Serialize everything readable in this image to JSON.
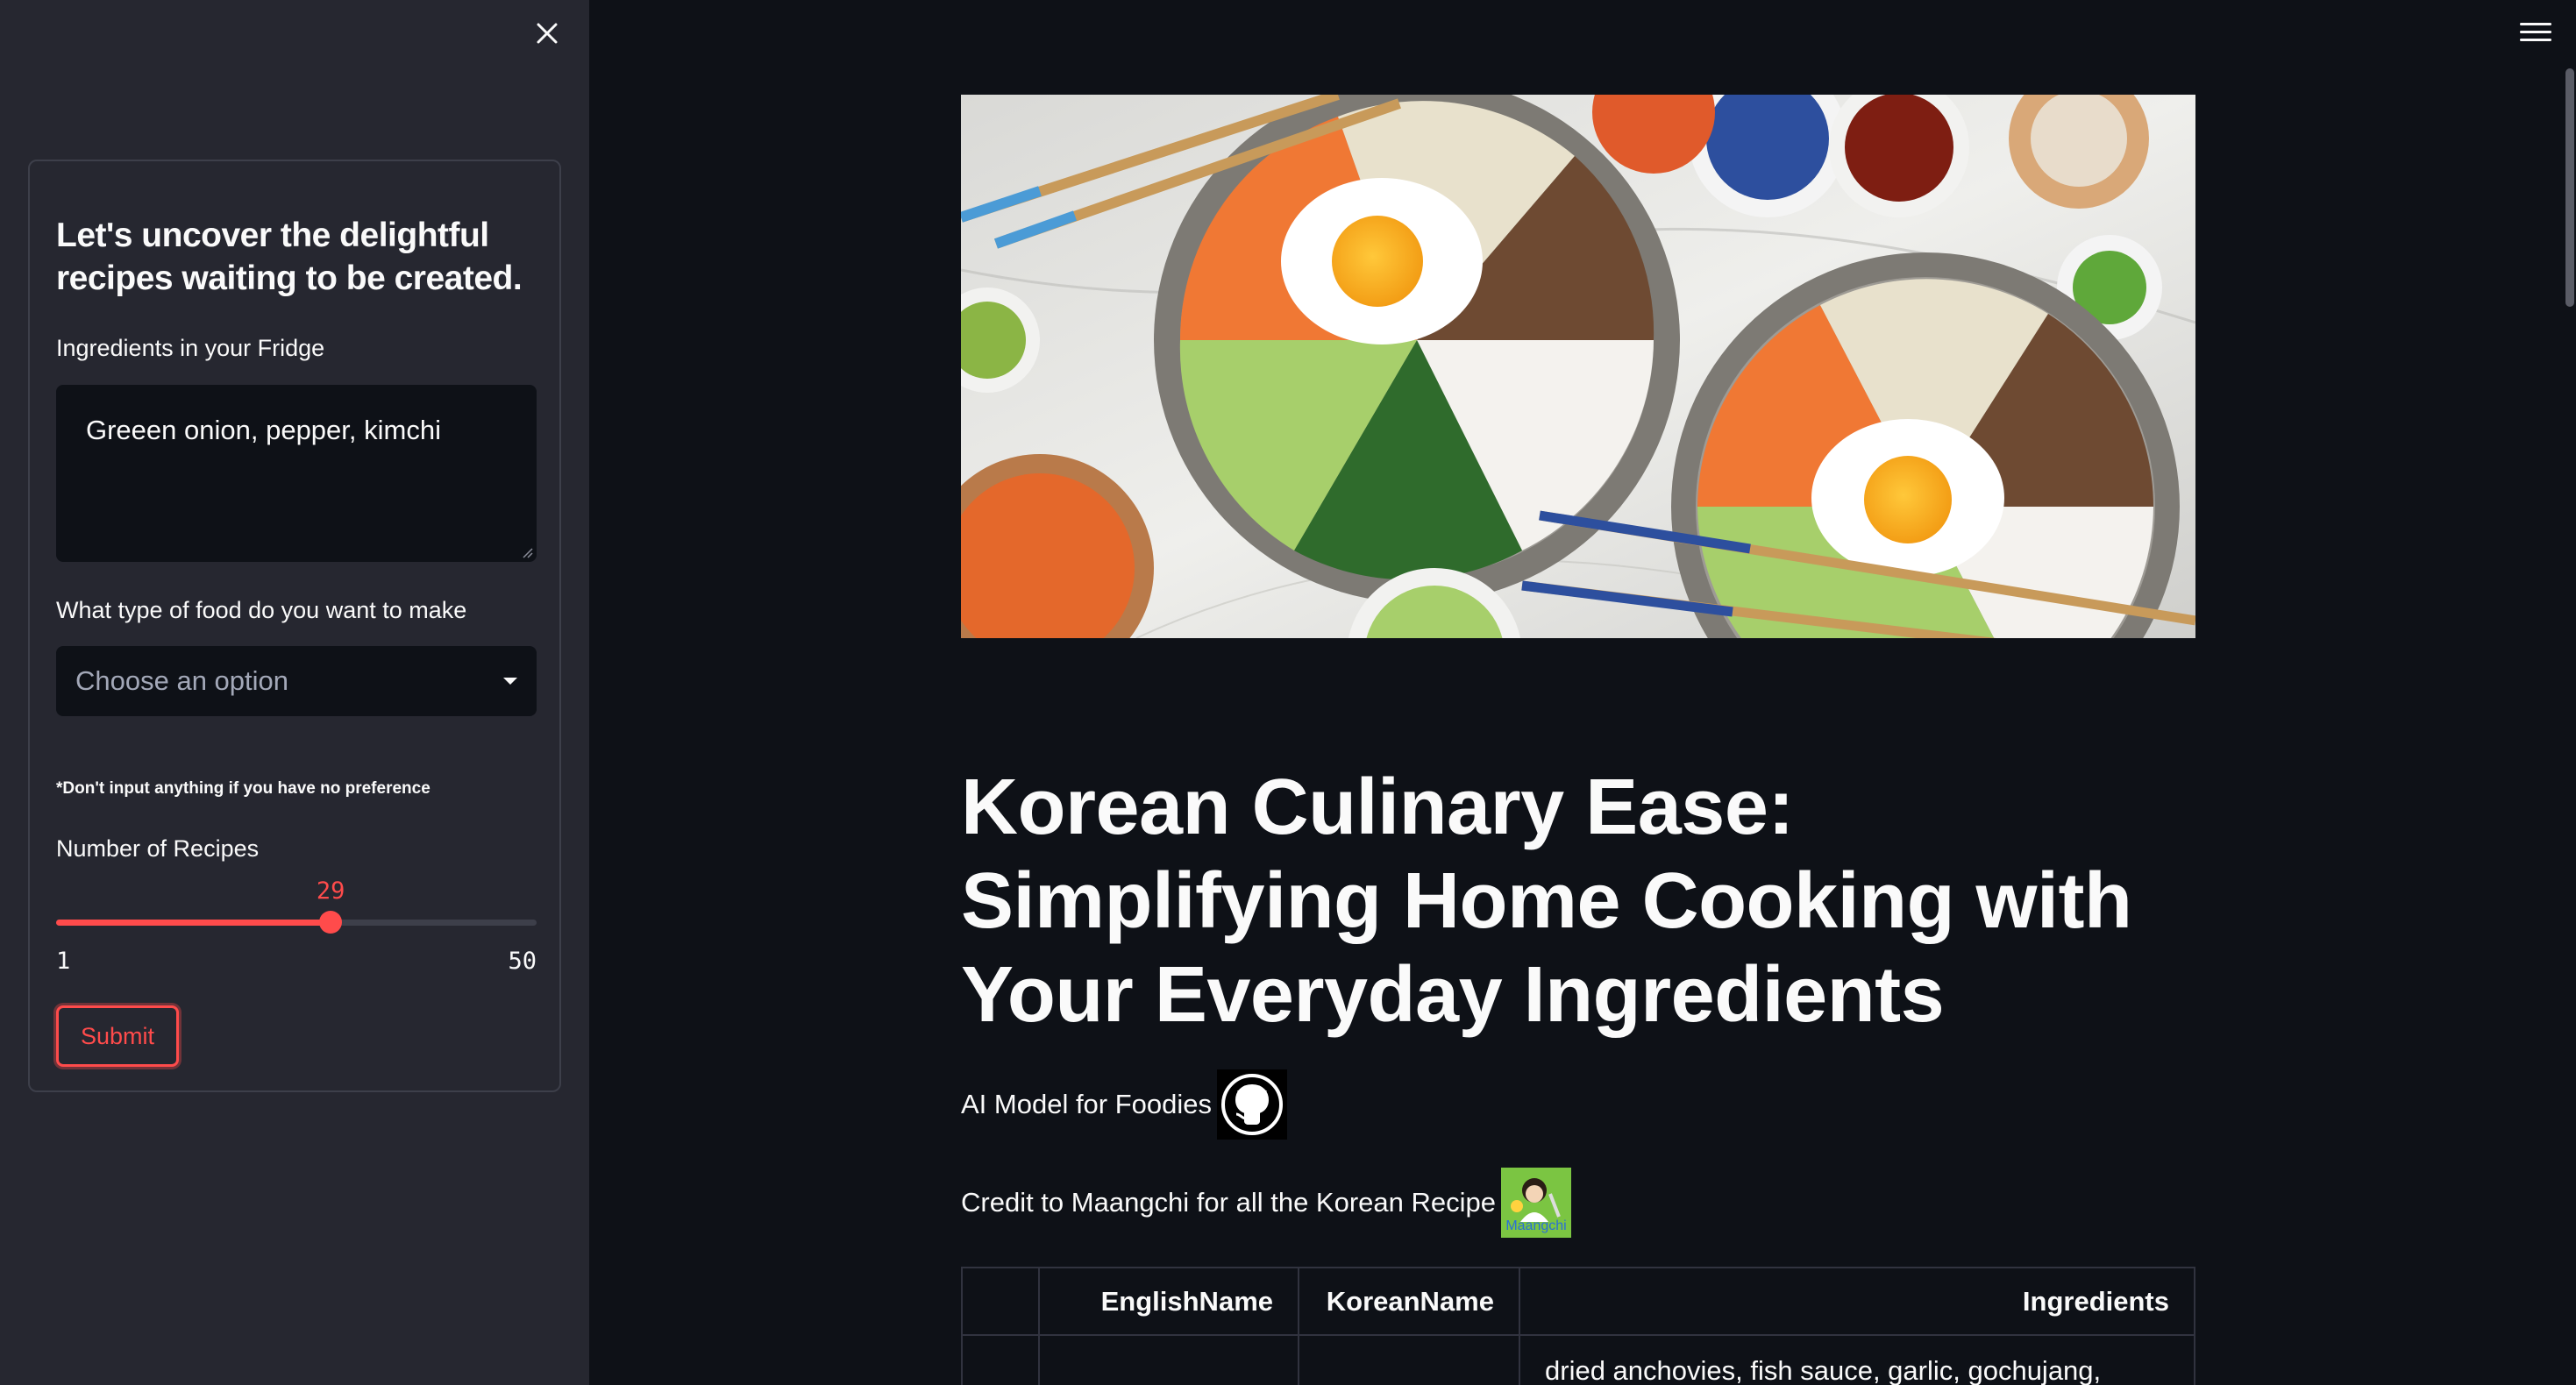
{
  "sidebar": {
    "form": {
      "title": "Let's uncover the delightful recipes waiting to be created.",
      "fridge_label": "Ingredients in your Fridge",
      "fridge_value": "Greeen onion, pepper, kimchi",
      "food_type_label": "What type of food do you want to make",
      "food_type_placeholder": "Choose an option",
      "note": "*Don't input anything if you have no preference",
      "recipes_label": "Number of Recipes",
      "slider": {
        "value": 29,
        "min": 1,
        "max": 50
      },
      "slider_value_text": "29",
      "slider_min_text": "1",
      "slider_max_text": "50",
      "submit_label": "Submit"
    }
  },
  "main": {
    "title": "Korean Culinary Ease: Simplifying Home Cooking with Your Everyday Ingredients",
    "ai_text": "AI Model for Foodies",
    "credit_text": "Credit to Maangchi for all the Korean Recipe",
    "maangchi_logo_text": "Maangchi",
    "table": {
      "headers": [
        "",
        "EnglishName",
        "KoreanName",
        "Ingredients"
      ],
      "rows": [
        [
          "",
          "",
          "",
          "dried anchovies, fish sauce, garlic, gochujang, green"
        ]
      ]
    }
  },
  "colors": {
    "accent": "#ff4b4b",
    "background": "#0e1117",
    "sidebar": "#262730"
  },
  "icons": [
    "close-icon",
    "menu-icon",
    "github-icon",
    "maangchi-logo-icon",
    "chevron-down-icon"
  ]
}
